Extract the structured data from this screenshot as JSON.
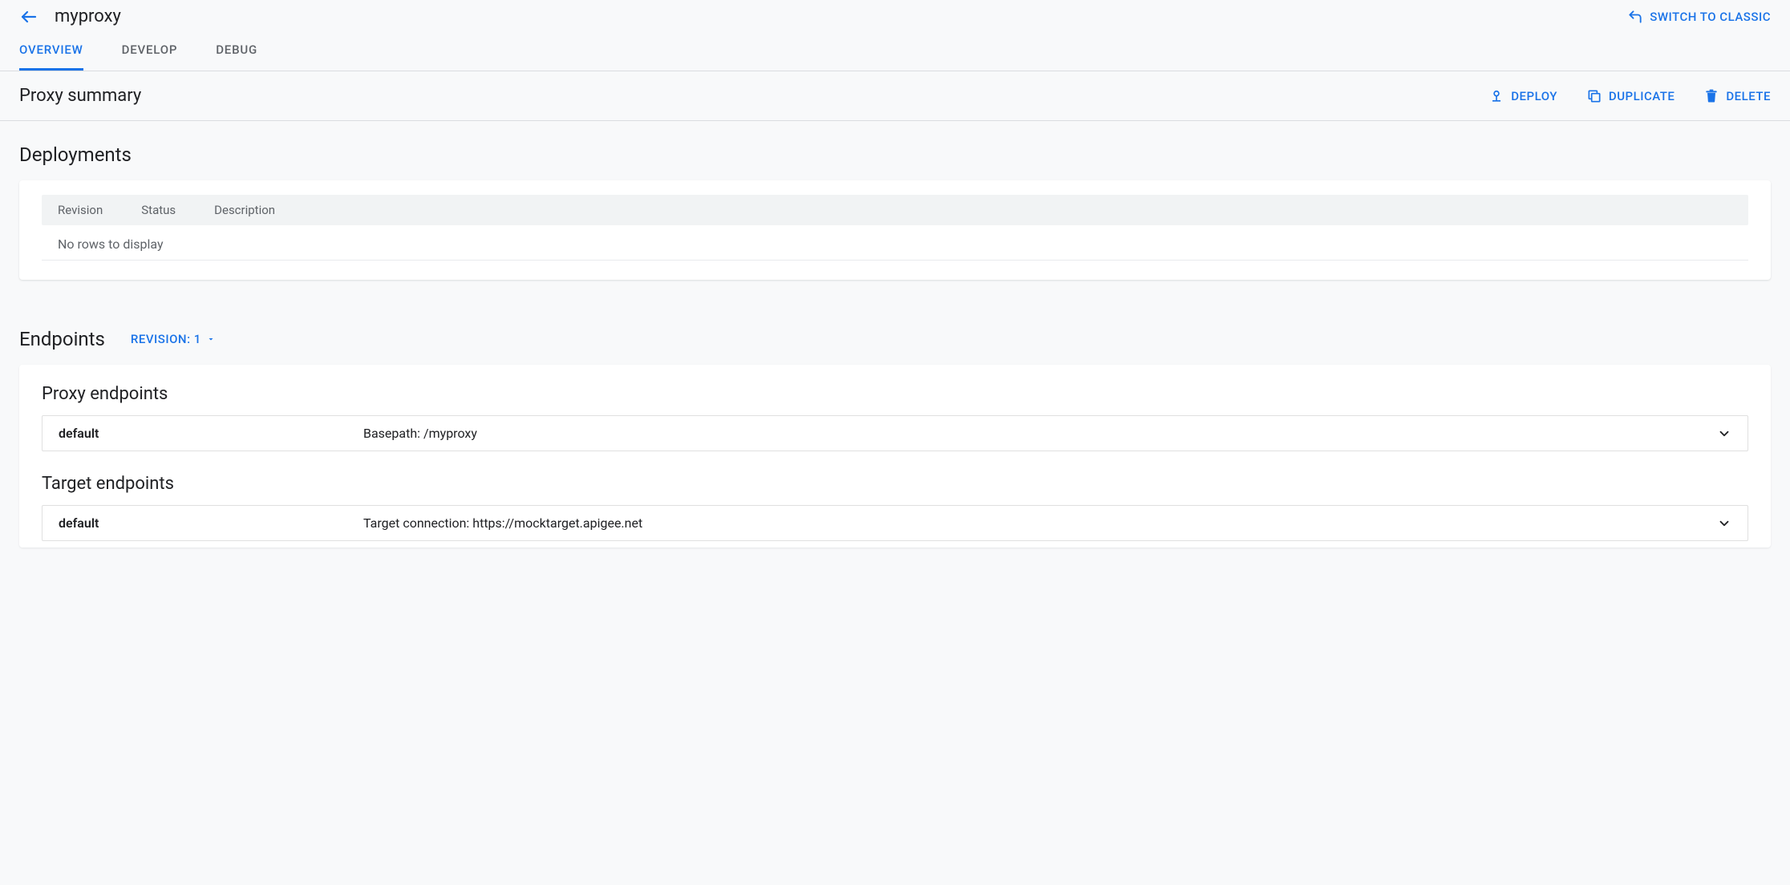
{
  "header": {
    "title": "myproxy",
    "switch_label": "SWITCH TO CLASSIC"
  },
  "tabs": {
    "overview": "OVERVIEW",
    "develop": "DEVELOP",
    "debug": "DEBUG"
  },
  "summary": {
    "title": "Proxy summary",
    "deploy": "DEPLOY",
    "duplicate": "DUPLICATE",
    "delete": "DELETE"
  },
  "deployments": {
    "title": "Deployments",
    "columns": {
      "revision": "Revision",
      "status": "Status",
      "description": "Description"
    },
    "empty": "No rows to display"
  },
  "endpoints": {
    "title": "Endpoints",
    "revision_label": "REVISION: 1",
    "proxy_title": "Proxy endpoints",
    "proxy_row": {
      "name": "default",
      "detail": "Basepath: /myproxy"
    },
    "target_title": "Target endpoints",
    "target_row": {
      "name": "default",
      "detail": "Target connection: https://mocktarget.apigee.net"
    }
  }
}
